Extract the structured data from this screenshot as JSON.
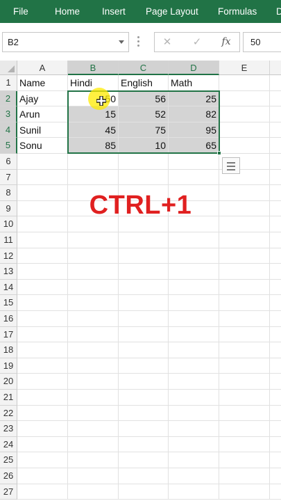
{
  "ribbon": {
    "tabs": [
      "File",
      "Home",
      "Insert",
      "Page Layout",
      "Formulas",
      "D"
    ]
  },
  "formula_bar": {
    "name_box": "B2",
    "cancel_glyph": "✕",
    "enter_glyph": "✓",
    "fx_glyph": "fx",
    "value": "50"
  },
  "sheet": {
    "columns": [
      "A",
      "B",
      "C",
      "D",
      "E"
    ],
    "rows": [
      "1",
      "2",
      "3",
      "4",
      "5",
      "6",
      "7",
      "8",
      "9",
      "10",
      "11",
      "12",
      "13",
      "14",
      "15",
      "16",
      "17",
      "18",
      "19",
      "20",
      "21",
      "22",
      "23",
      "24",
      "25",
      "26",
      "27"
    ],
    "headers": [
      "Name",
      "Hindi",
      "English",
      "Math"
    ],
    "data": [
      [
        "Ajay",
        "50",
        "56",
        "25"
      ],
      [
        "Arun",
        "15",
        "52",
        "82"
      ],
      [
        "Sunil",
        "45",
        "75",
        "95"
      ],
      [
        "Sonu",
        "85",
        "10",
        "65"
      ]
    ]
  },
  "overlay_text": "CTRL+1",
  "colors": {
    "ribbon": "#217346",
    "selection": "#217346",
    "overlay": "#e02020",
    "highlight": "#ffeb00"
  }
}
